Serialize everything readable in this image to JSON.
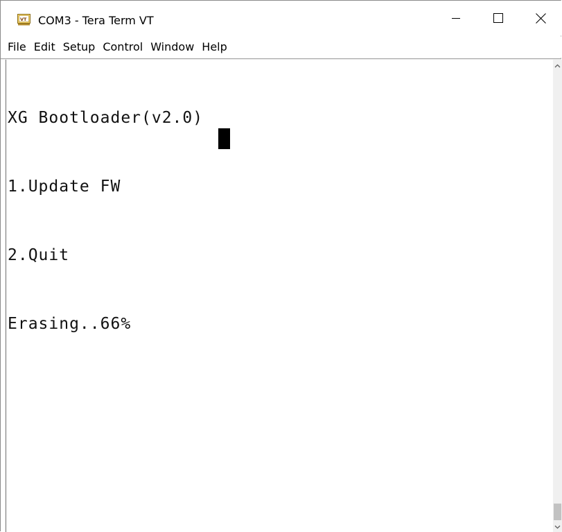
{
  "window": {
    "title": "COM3 - Tera Term VT",
    "icon": "tera-term-vt-icon",
    "controls": {
      "minimize": "minimize-icon",
      "maximize": "maximize-icon",
      "close": "close-icon"
    }
  },
  "menu": {
    "items": [
      {
        "label": "File"
      },
      {
        "label": "Edit"
      },
      {
        "label": "Setup"
      },
      {
        "label": "Control"
      },
      {
        "label": "Window"
      },
      {
        "label": "Help"
      }
    ]
  },
  "terminal": {
    "lines": [
      "XG Bootloader(v2.0)",
      "1.Update FW",
      "2.Quit",
      "Erasing..66%"
    ],
    "erase_progress_percent": 66,
    "text_color": "#111111",
    "background_color": "#ffffff",
    "cursor_color": "#000000"
  },
  "scrollbar": {
    "up_icon": "scroll-up-arrow-icon",
    "down_icon": "scroll-down-arrow-icon"
  }
}
